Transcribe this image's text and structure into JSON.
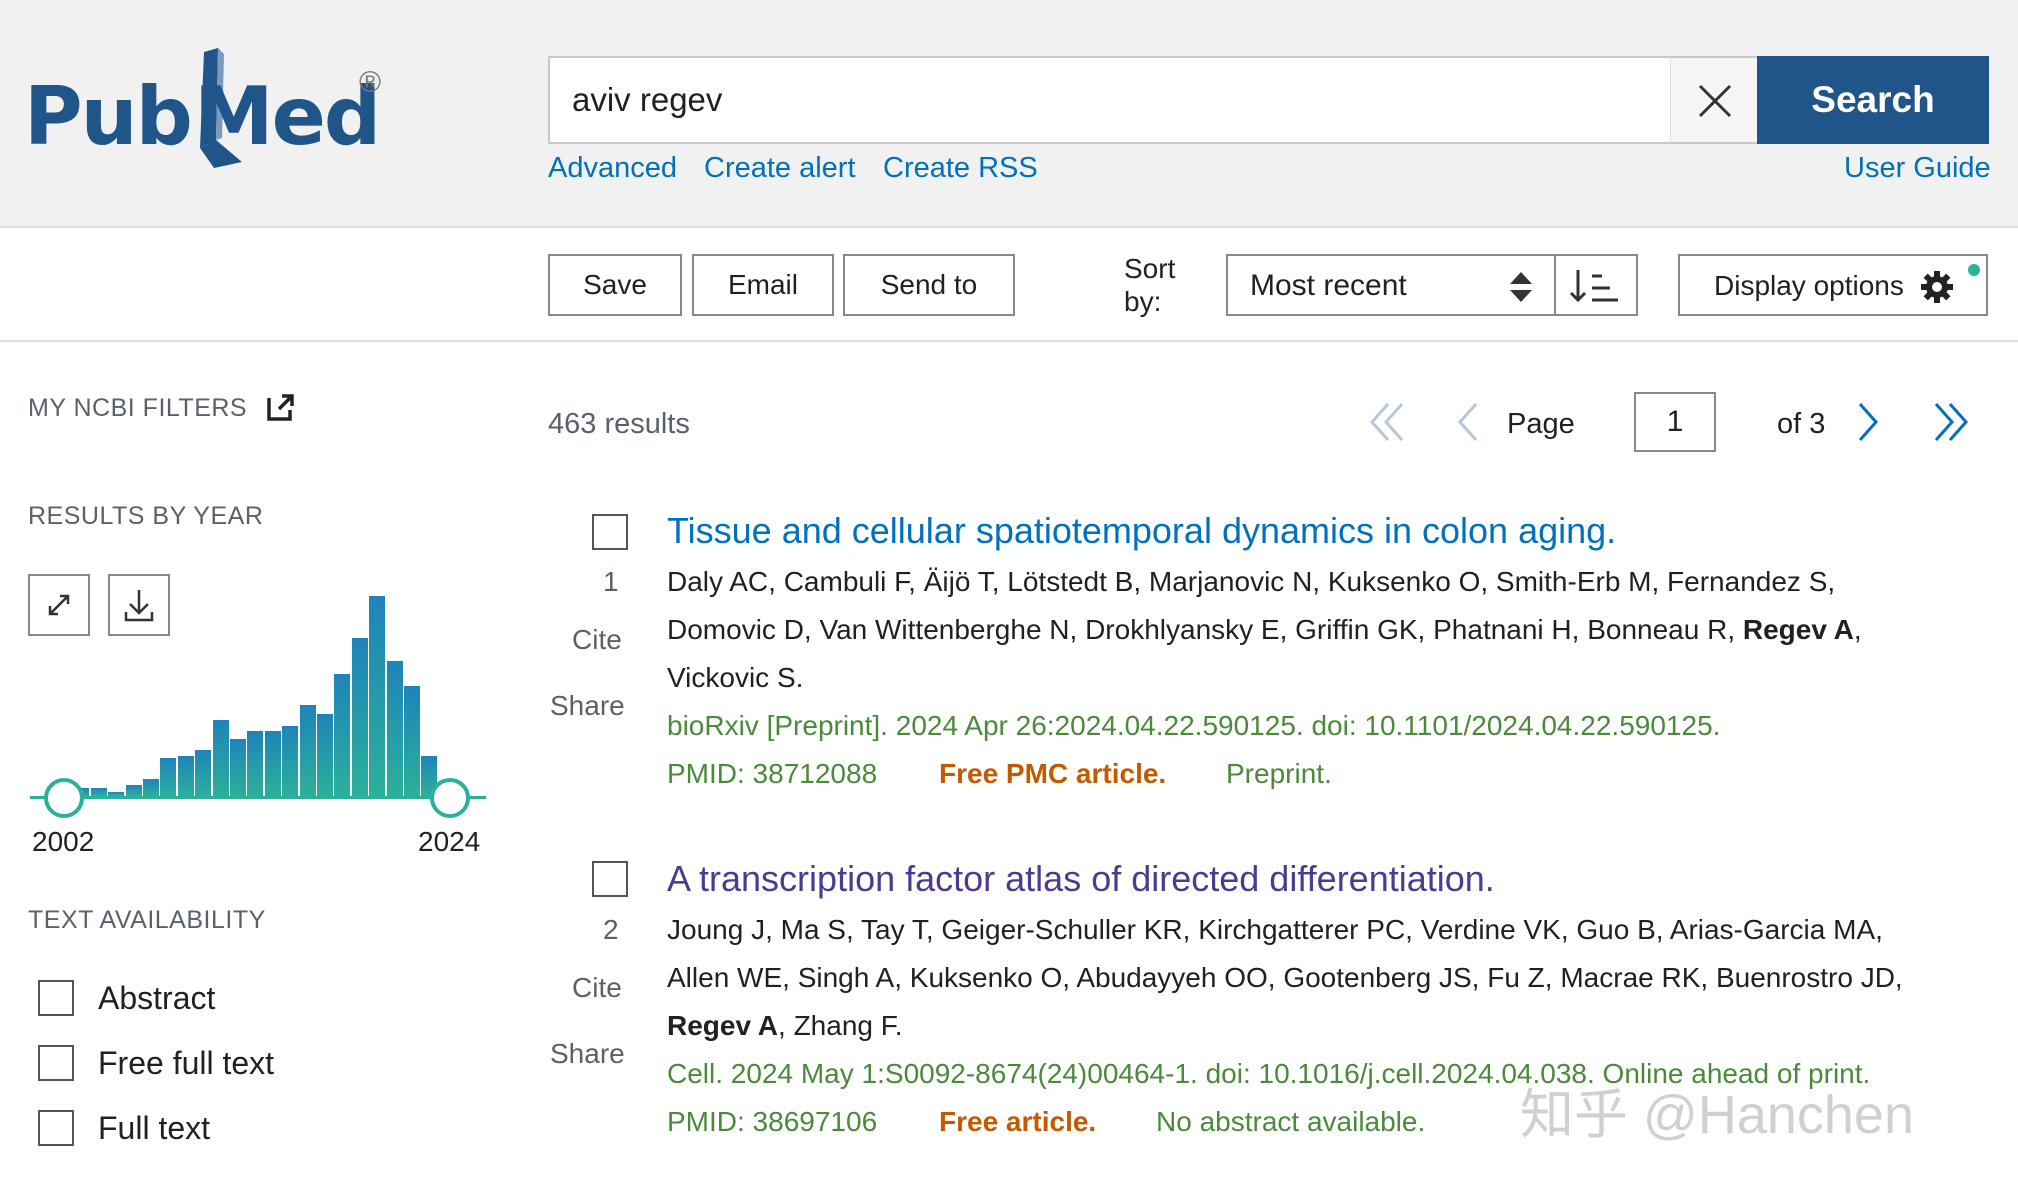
{
  "header": {
    "logo_text_left": "Pub",
    "logo_text_right": "Med",
    "logo_registered": "®",
    "search_value": "aviv regev",
    "search_button": "Search",
    "links": [
      "Advanced",
      "Create alert",
      "Create RSS"
    ],
    "user_guide": "User Guide"
  },
  "toolbar": {
    "save": "Save",
    "email": "Email",
    "send_to": "Send to",
    "sort_label_1": "Sort",
    "sort_label_2": "by:",
    "sort_value": "Most recent",
    "display_options": "Display options"
  },
  "sidebar": {
    "my_ncbi_filters": "MY NCBI FILTERS",
    "results_by_year": "RESULTS BY YEAR",
    "year_start": "2002",
    "year_end": "2024",
    "text_availability": "TEXT AVAILABILITY",
    "filters": [
      "Abstract",
      "Free full text",
      "Full text"
    ]
  },
  "chart_data": {
    "type": "bar",
    "title": "RESULTS BY YEAR",
    "categories": [
      "2002",
      "2003",
      "2004",
      "2005",
      "2006",
      "2007",
      "2008",
      "2009",
      "2010",
      "2011",
      "2012",
      "2013",
      "2014",
      "2015",
      "2016",
      "2017",
      "2018",
      "2019",
      "2020",
      "2021",
      "2022",
      "2023",
      "2024"
    ],
    "values": [
      5,
      4,
      4,
      2,
      6,
      9,
      20,
      21,
      24,
      40,
      30,
      34,
      34,
      37,
      48,
      43,
      64,
      83,
      105,
      71,
      58,
      21,
      8
    ],
    "colors": {
      "top": "#1f83ba",
      "bottom": "#2bb09a"
    }
  },
  "results": {
    "count": "463 results",
    "page_label": "Page",
    "page_value": "1",
    "of_pages": "of 3",
    "items": [
      {
        "index": "1",
        "title": "Tissue and cellular spatiotemporal dynamics in colon aging.",
        "authors_line1": "Daly AC, Cambuli F, Äijö T, Lötstedt B, Marjanovic N, Kuksenko O, Smith-Erb M, Fernandez S,",
        "authors_line2_pre": "Domovic D, Van Wittenberghe N, Drokhlyansky E, Griffin GK, Phatnani H, Bonneau R, ",
        "authors_line2_bold": "Regev A",
        "authors_line2_post": ",",
        "authors_line3": "Vickovic S.",
        "journal": "bioRxiv [Preprint]. 2024 Apr 26:2024.04.22.590125. doi: 10.1101/2024.04.22.590125.",
        "pmid": "PMID: 38712088",
        "free": "Free PMC article.",
        "extra": "Preprint.",
        "cite": "Cite",
        "share": "Share"
      },
      {
        "index": "2",
        "title": "A transcription factor atlas of directed differentiation.",
        "authors_line1": "Joung J, Ma S, Tay T, Geiger-Schuller KR, Kirchgatterer PC, Verdine VK, Guo B, Arias-Garcia MA,",
        "authors_line2": "Allen WE, Singh A, Kuksenko O, Abudayyeh OO, Gootenberg JS, Fu Z, Macrae RK, Buenrostro JD,",
        "authors_line3_bold": "Regev A",
        "authors_line3_post": ", Zhang F.",
        "journal": "Cell. 2024 May 1:S0092-8674(24)00464-1. doi: 10.1016/j.cell.2024.04.038. Online ahead of print.",
        "pmid": "PMID: 38697106",
        "free": "Free article.",
        "extra": "No abstract available.",
        "cite": "Cite",
        "share": "Share"
      }
    ]
  },
  "watermark": "知乎 @Hanchen"
}
